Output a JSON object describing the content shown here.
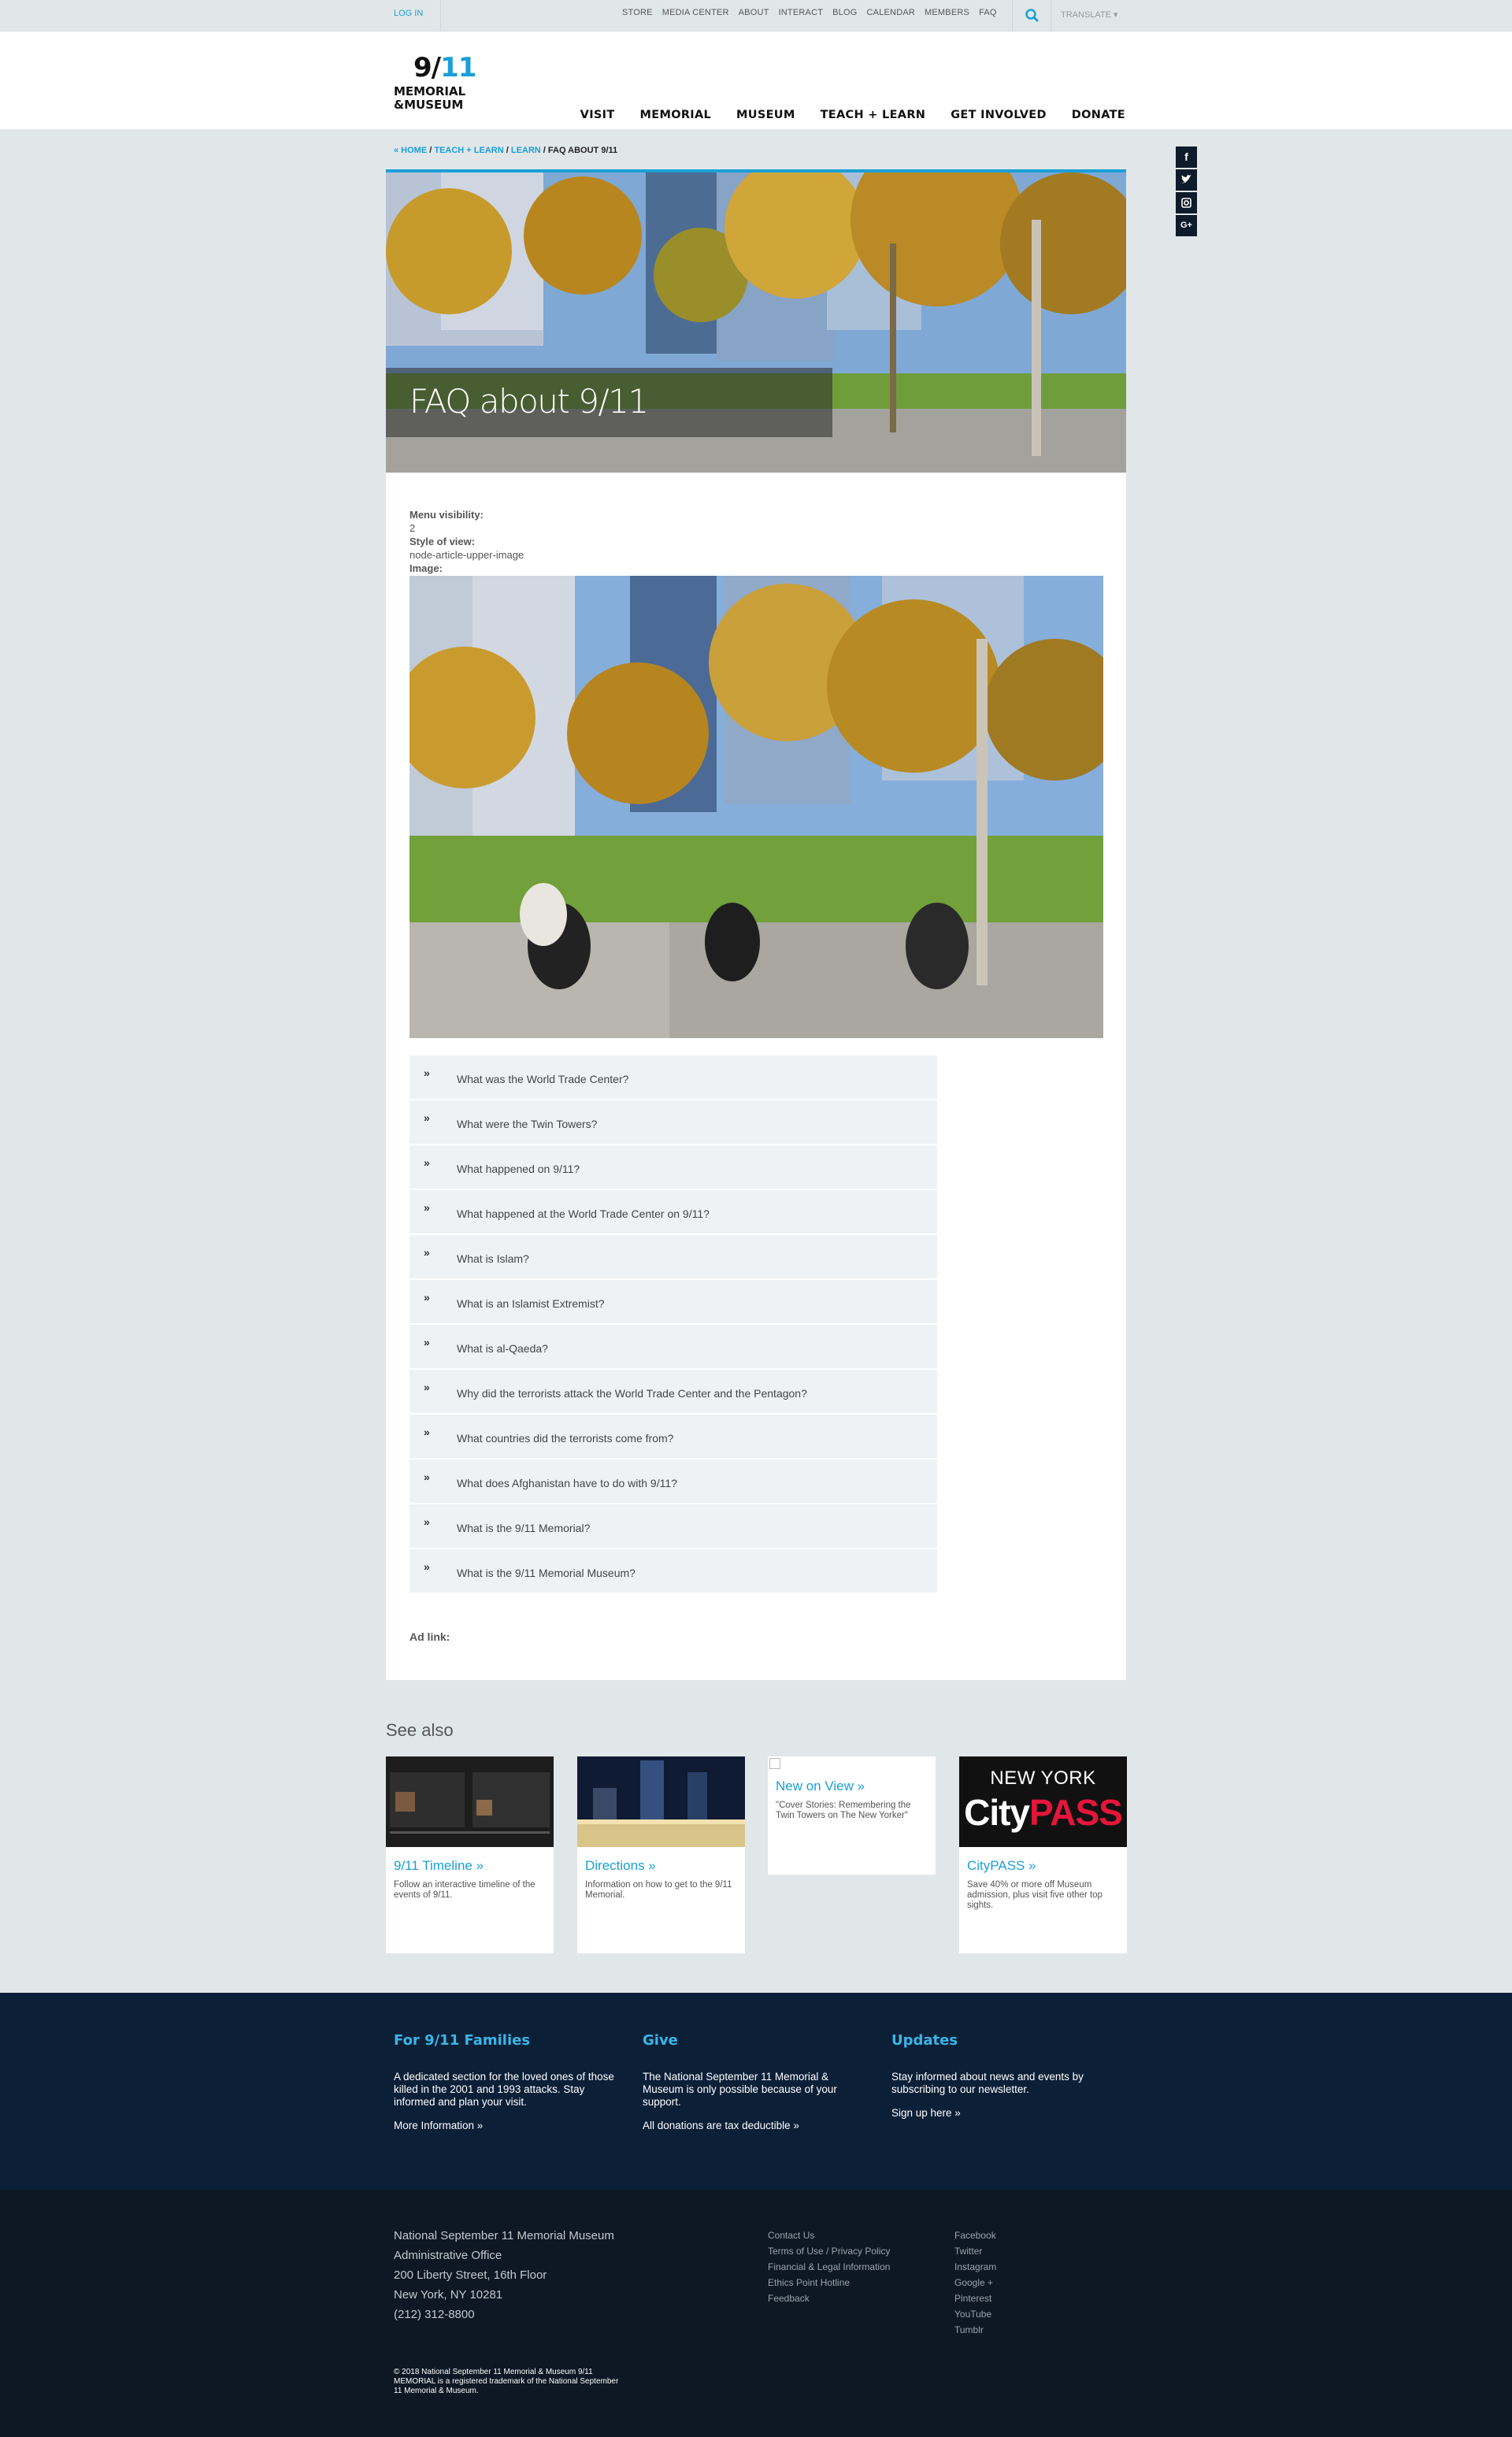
{
  "utility": {
    "login": "LOG IN",
    "links": [
      "STORE",
      "MEDIA CENTER",
      "ABOUT",
      "INTERACT",
      "BLOG",
      "CALENDAR",
      "MEMBERS",
      "FAQ"
    ],
    "translate": "TRANSLATE ▾",
    "search_icon": "search-icon"
  },
  "logo": {
    "number_a": "9/",
    "number_b": "11",
    "line1": "MEMORIAL",
    "line2": "&MUSEUM"
  },
  "nav": [
    "VISIT",
    "MEMORIAL",
    "MUSEUM",
    "TEACH + LEARN",
    "GET INVOLVED",
    "DONATE"
  ],
  "breadcrumb": {
    "home": "« HOME",
    "teach": "TEACH + LEARN",
    "learn": "LEARN",
    "current": "FAQ ABOUT 9/11",
    "sep": " / "
  },
  "social": [
    "f",
    "t",
    "◎",
    "G+"
  ],
  "hero": {
    "title": "FAQ about 9/11"
  },
  "fields": {
    "menu_visibility_label": "Menu visibility:",
    "menu_visibility_value": "2",
    "style_label": "Style of view:",
    "style_value": "node-article-upper-image",
    "image_label": "Image:"
  },
  "faq": [
    "What was the World Trade Center?",
    "What were the Twin Towers?",
    "What happened on 9/11?",
    "What happened at the World Trade Center on 9/11?",
    "What is Islam?",
    "What is an Islamist Extremist?",
    "What is al-Qaeda?",
    "Why did the terrorists attack the World Trade Center and the Pentagon?",
    "What countries did the terrorists come from?",
    "What does Afghanistan have to do with 9/11?",
    "What is the 9/11 Memorial?",
    "What is the 9/11 Memorial Museum?"
  ],
  "faq_chevron": "»",
  "ad_link": "Ad link:",
  "see_also": {
    "title": "See also",
    "tiles": [
      {
        "title": "9/11 Timeline »",
        "desc": "Follow an interactive timeline of the events of 9/11."
      },
      {
        "title": "Directions »",
        "desc": "Information on how to get to the 9/11 Memorial."
      },
      {
        "title": "New on View »",
        "desc": "\"Cover Stories: Remembering the Twin Towers on The New Yorker\""
      },
      {
        "title": "CityPASS »",
        "desc": "Save 40% or more off Museum admission, plus visit five other top sights."
      }
    ],
    "citypass_top": "NEW YORK",
    "citypass_city": "City",
    "citypass_pass": "PASS"
  },
  "promo": {
    "families": {
      "heading": "For 9/11 Families",
      "text": "A dedicated section for the loved ones of those killed in the 2001 and 1993 attacks. Stay informed and plan your visit.",
      "link": "More Information »"
    },
    "give": {
      "heading": "Give",
      "text": "The National September 11 Memorial & Museum is only possible because of your support.",
      "link": "All donations are tax deductible »"
    },
    "updates": {
      "heading": "Updates",
      "text": "Stay informed about news and events by subscribing to our newsletter.",
      "link": "Sign up here »"
    }
  },
  "footer": {
    "address": [
      "National September 11 Memorial Museum",
      "Administrative Office",
      "200 Liberty Street, 16th Floor",
      "New York, NY 10281",
      "(212) 312-8800"
    ],
    "links1": [
      "Contact Us",
      "Terms of Use / Privacy Policy",
      "Financial & Legal Information",
      "Ethics Point Hotline",
      "Feedback"
    ],
    "links2": [
      "Facebook",
      "Twitter",
      "Instagram",
      "Google +",
      "Pinterest",
      "YouTube",
      "Tumblr"
    ],
    "copyright": "© 2018 National September 11 Memorial & Museum 9/11 MEMORIAL is a registered trademark of the National September 11 Memorial & Museum."
  },
  "colors": {
    "accent": "#1a9fd6",
    "navy": "#0b2037",
    "footer": "#0d1824",
    "page_bg": "#e1e6e9"
  }
}
